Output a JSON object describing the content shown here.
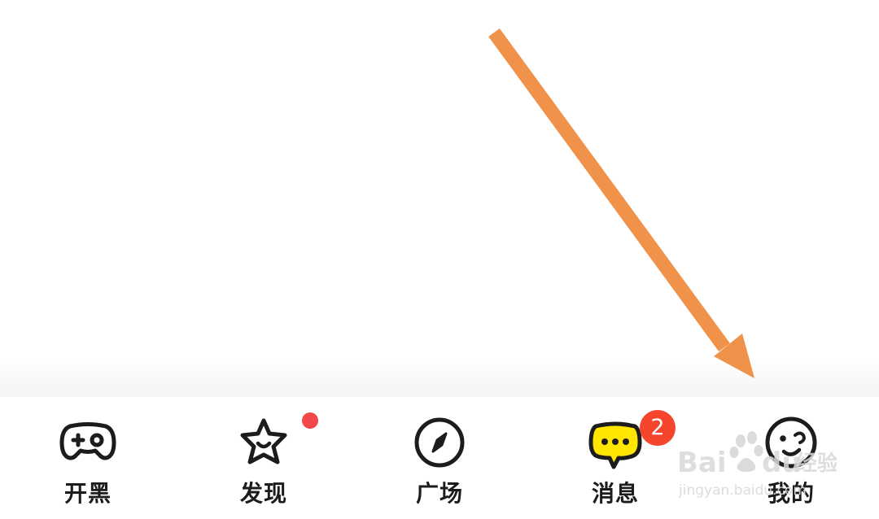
{
  "annotation": {
    "arrow_color": "#F0924A",
    "arrow_icon": "arrow-down-right-icon"
  },
  "bottom_nav": {
    "tabs": [
      {
        "id": "kaihei",
        "label": "开黑",
        "icon": "gamepad-icon"
      },
      {
        "id": "faxian",
        "label": "发现",
        "icon": "star-icon",
        "has_dot": true
      },
      {
        "id": "guangchang",
        "label": "广场",
        "icon": "compass-icon"
      },
      {
        "id": "xiaoxi",
        "label": "消息",
        "icon": "chat-bubble-icon",
        "badge": "2"
      },
      {
        "id": "wode",
        "label": "我的",
        "icon": "face-icon"
      }
    ],
    "dot_color": "#F4474A",
    "badge_color": "#F5452D",
    "message_icon_color": "#FFE600"
  },
  "watermark": {
    "brand": "Baidu经验",
    "url": "jingyan.baidu.com"
  }
}
